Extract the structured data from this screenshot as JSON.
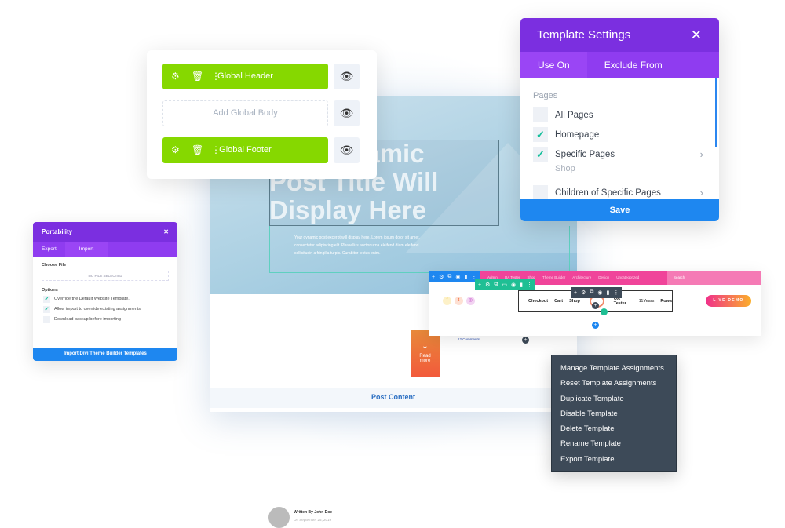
{
  "global_card": {
    "header_label": "Global Header",
    "body_placeholder": "Add Global Body",
    "footer_label": "Global Footer"
  },
  "template_settings": {
    "title": "Template Settings",
    "tabs": [
      "Use On",
      "Exclude From"
    ],
    "section_label": "Pages",
    "items": [
      {
        "label": "All Pages",
        "checked": false
      },
      {
        "label": "Homepage",
        "checked": true
      },
      {
        "label": "Specific Pages",
        "checked": true,
        "sub": "Shop"
      },
      {
        "label": "Children of Specific Pages",
        "checked": false
      }
    ],
    "save_label": "Save"
  },
  "portability": {
    "title": "Portability",
    "tabs": [
      "Export",
      "Import"
    ],
    "choose_file_label": "Choose File",
    "no_file": "NO FILE SELECTED",
    "options_label": "Options",
    "options": [
      {
        "label": "Override the Default Website Template.",
        "checked": true
      },
      {
        "label": "Allow import to override existing assignments",
        "checked": true
      },
      {
        "label": "Download backup before importing",
        "checked": false
      }
    ],
    "import_button": "Import Divi Theme Builder Templates"
  },
  "post": {
    "title_line1": "Dynamic",
    "title_line2": "Post Title Will",
    "title_line3": "Display Here",
    "excerpt": "Your dynamic post excerpt will display here. Lorem ipsum dolor sit amet, consectetur adipiscing elit. Phasellus auctor urna eleifend diam eleifend sollicitudin a fringilla turpis. Curabitur lectus enim.",
    "author": "Written By John Doe",
    "date": "On September 25, 2019",
    "read_more": "Read more",
    "comments": "12 Comments",
    "post_content": "Post Content"
  },
  "builder": {
    "top_menu": [
      "Admin",
      "QA Tester",
      "Shop",
      "Theme Builder",
      "Architecture",
      "Design",
      "Uncategorized"
    ],
    "search": "Search",
    "nav_menu": [
      "Checkout",
      "Cart",
      "Shop",
      "QA Tester",
      "11Years",
      "Rows"
    ],
    "live_demo": "LIVE DEMO"
  },
  "context_menu": {
    "items": [
      "Manage Template Assignments",
      "Reset Template Assignments",
      "Duplicate Template",
      "Disable Template",
      "Delete Template",
      "Rename Template",
      "Export Template"
    ]
  },
  "colors": {
    "purple": "#7b2fe0",
    "green": "#86d800",
    "blue": "#1e87f0",
    "teal": "#12bf9a",
    "pink": "#f0449a"
  }
}
